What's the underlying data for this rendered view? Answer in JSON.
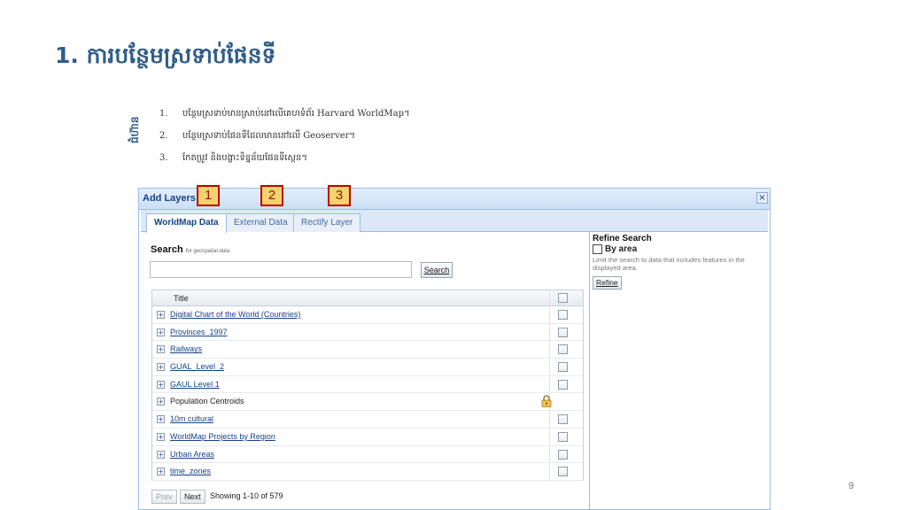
{
  "slide": {
    "title": "1. ការបន្ថែមស្រទាប់ផែនទី",
    "side_label": "ជំហ៊ាន",
    "page_number": "9",
    "steps": [
      {
        "num": "1.",
        "text": "បន្ថែមស្រទាប់មានស្រាប់នៅលើគេហទំព័រ Harvard WorldMap។"
      },
      {
        "num": "2.",
        "text": "បន្ថែមស្រទាប់ផែនទីដែលមាននៅលើ Geoserver។"
      },
      {
        "num": "3.",
        "text": "កែតម្រូវ និងបង្ហាះទិន្នន័យផែនទីស្កេន។"
      }
    ]
  },
  "callouts": [
    "1",
    "2",
    "3"
  ],
  "dialog": {
    "title": "Add Layers",
    "close_glyph": "×",
    "tabs": [
      {
        "label": "WorldMap Data",
        "active": true
      },
      {
        "label": "External Data",
        "active": false
      },
      {
        "label": "Rectify Layer",
        "active": false
      }
    ],
    "search": {
      "label": "Search",
      "hint": "for geospatial data",
      "input_value": "",
      "button_label": "Search"
    },
    "grid": {
      "column_title": "Title",
      "expander_glyph": "+",
      "rows": [
        {
          "title": "Digital Chart of the World (Countries)",
          "link": true,
          "locked": false
        },
        {
          "title": "Provinces_1997",
          "link": true,
          "locked": false
        },
        {
          "title": "Railways",
          "link": true,
          "locked": false
        },
        {
          "title": "GUAL_Level_2",
          "link": true,
          "locked": false
        },
        {
          "title": "GAUL Level 1",
          "link": true,
          "locked": false
        },
        {
          "title": "Population Centroids",
          "link": false,
          "locked": true
        },
        {
          "title": "10m cultural",
          "link": true,
          "locked": false
        },
        {
          "title": "WorldMap Projects by Region",
          "link": true,
          "locked": false
        },
        {
          "title": "Urban Areas",
          "link": true,
          "locked": false
        },
        {
          "title": "time_zones",
          "link": true,
          "locked": false
        }
      ]
    },
    "pager": {
      "prev_label": "Prev",
      "next_label": "Next",
      "status": "Showing 1-10 of 579"
    },
    "refine": {
      "title": "Refine Search",
      "by_area_label": "By area",
      "by_area_checked": false,
      "description": "Limit the search to data that includes features in the displayed area.",
      "button_label": "Refine"
    }
  },
  "colors": {
    "title_blue": "#2f5d8a",
    "header_blue": "#15428b",
    "callout_border": "#c00000",
    "callout_fill": "#f3d36e"
  }
}
